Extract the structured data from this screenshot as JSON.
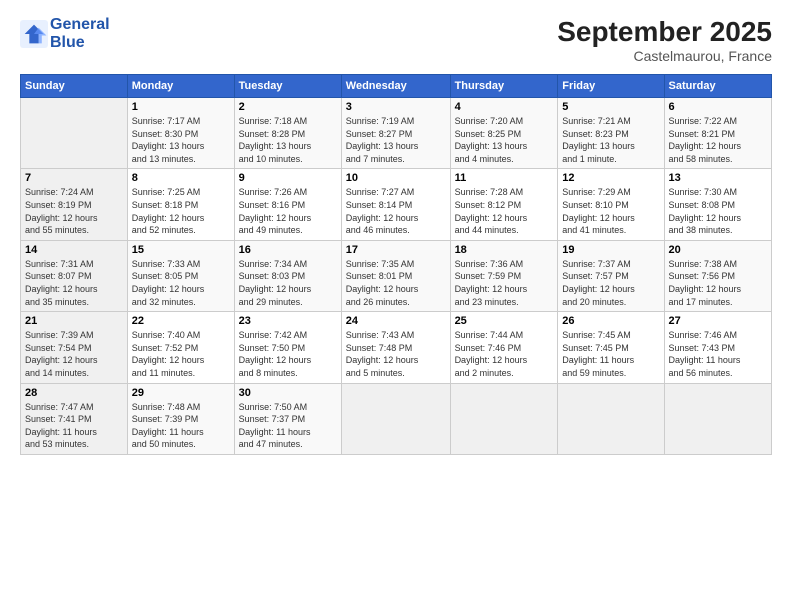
{
  "header": {
    "logo_line1": "General",
    "logo_line2": "Blue",
    "month": "September 2025",
    "location": "Castelmaurou, France"
  },
  "columns": [
    "Sunday",
    "Monday",
    "Tuesday",
    "Wednesday",
    "Thursday",
    "Friday",
    "Saturday"
  ],
  "weeks": [
    [
      {
        "day": "",
        "info": ""
      },
      {
        "day": "1",
        "info": "Sunrise: 7:17 AM\nSunset: 8:30 PM\nDaylight: 13 hours\nand 13 minutes."
      },
      {
        "day": "2",
        "info": "Sunrise: 7:18 AM\nSunset: 8:28 PM\nDaylight: 13 hours\nand 10 minutes."
      },
      {
        "day": "3",
        "info": "Sunrise: 7:19 AM\nSunset: 8:27 PM\nDaylight: 13 hours\nand 7 minutes."
      },
      {
        "day": "4",
        "info": "Sunrise: 7:20 AM\nSunset: 8:25 PM\nDaylight: 13 hours\nand 4 minutes."
      },
      {
        "day": "5",
        "info": "Sunrise: 7:21 AM\nSunset: 8:23 PM\nDaylight: 13 hours\nand 1 minute."
      },
      {
        "day": "6",
        "info": "Sunrise: 7:22 AM\nSunset: 8:21 PM\nDaylight: 12 hours\nand 58 minutes."
      }
    ],
    [
      {
        "day": "7",
        "info": "Sunrise: 7:24 AM\nSunset: 8:19 PM\nDaylight: 12 hours\nand 55 minutes."
      },
      {
        "day": "8",
        "info": "Sunrise: 7:25 AM\nSunset: 8:18 PM\nDaylight: 12 hours\nand 52 minutes."
      },
      {
        "day": "9",
        "info": "Sunrise: 7:26 AM\nSunset: 8:16 PM\nDaylight: 12 hours\nand 49 minutes."
      },
      {
        "day": "10",
        "info": "Sunrise: 7:27 AM\nSunset: 8:14 PM\nDaylight: 12 hours\nand 46 minutes."
      },
      {
        "day": "11",
        "info": "Sunrise: 7:28 AM\nSunset: 8:12 PM\nDaylight: 12 hours\nand 44 minutes."
      },
      {
        "day": "12",
        "info": "Sunrise: 7:29 AM\nSunset: 8:10 PM\nDaylight: 12 hours\nand 41 minutes."
      },
      {
        "day": "13",
        "info": "Sunrise: 7:30 AM\nSunset: 8:08 PM\nDaylight: 12 hours\nand 38 minutes."
      }
    ],
    [
      {
        "day": "14",
        "info": "Sunrise: 7:31 AM\nSunset: 8:07 PM\nDaylight: 12 hours\nand 35 minutes."
      },
      {
        "day": "15",
        "info": "Sunrise: 7:33 AM\nSunset: 8:05 PM\nDaylight: 12 hours\nand 32 minutes."
      },
      {
        "day": "16",
        "info": "Sunrise: 7:34 AM\nSunset: 8:03 PM\nDaylight: 12 hours\nand 29 minutes."
      },
      {
        "day": "17",
        "info": "Sunrise: 7:35 AM\nSunset: 8:01 PM\nDaylight: 12 hours\nand 26 minutes."
      },
      {
        "day": "18",
        "info": "Sunrise: 7:36 AM\nSunset: 7:59 PM\nDaylight: 12 hours\nand 23 minutes."
      },
      {
        "day": "19",
        "info": "Sunrise: 7:37 AM\nSunset: 7:57 PM\nDaylight: 12 hours\nand 20 minutes."
      },
      {
        "day": "20",
        "info": "Sunrise: 7:38 AM\nSunset: 7:56 PM\nDaylight: 12 hours\nand 17 minutes."
      }
    ],
    [
      {
        "day": "21",
        "info": "Sunrise: 7:39 AM\nSunset: 7:54 PM\nDaylight: 12 hours\nand 14 minutes."
      },
      {
        "day": "22",
        "info": "Sunrise: 7:40 AM\nSunset: 7:52 PM\nDaylight: 12 hours\nand 11 minutes."
      },
      {
        "day": "23",
        "info": "Sunrise: 7:42 AM\nSunset: 7:50 PM\nDaylight: 12 hours\nand 8 minutes."
      },
      {
        "day": "24",
        "info": "Sunrise: 7:43 AM\nSunset: 7:48 PM\nDaylight: 12 hours\nand 5 minutes."
      },
      {
        "day": "25",
        "info": "Sunrise: 7:44 AM\nSunset: 7:46 PM\nDaylight: 12 hours\nand 2 minutes."
      },
      {
        "day": "26",
        "info": "Sunrise: 7:45 AM\nSunset: 7:45 PM\nDaylight: 11 hours\nand 59 minutes."
      },
      {
        "day": "27",
        "info": "Sunrise: 7:46 AM\nSunset: 7:43 PM\nDaylight: 11 hours\nand 56 minutes."
      }
    ],
    [
      {
        "day": "28",
        "info": "Sunrise: 7:47 AM\nSunset: 7:41 PM\nDaylight: 11 hours\nand 53 minutes."
      },
      {
        "day": "29",
        "info": "Sunrise: 7:48 AM\nSunset: 7:39 PM\nDaylight: 11 hours\nand 50 minutes."
      },
      {
        "day": "30",
        "info": "Sunrise: 7:50 AM\nSunset: 7:37 PM\nDaylight: 11 hours\nand 47 minutes."
      },
      {
        "day": "",
        "info": ""
      },
      {
        "day": "",
        "info": ""
      },
      {
        "day": "",
        "info": ""
      },
      {
        "day": "",
        "info": ""
      }
    ]
  ]
}
